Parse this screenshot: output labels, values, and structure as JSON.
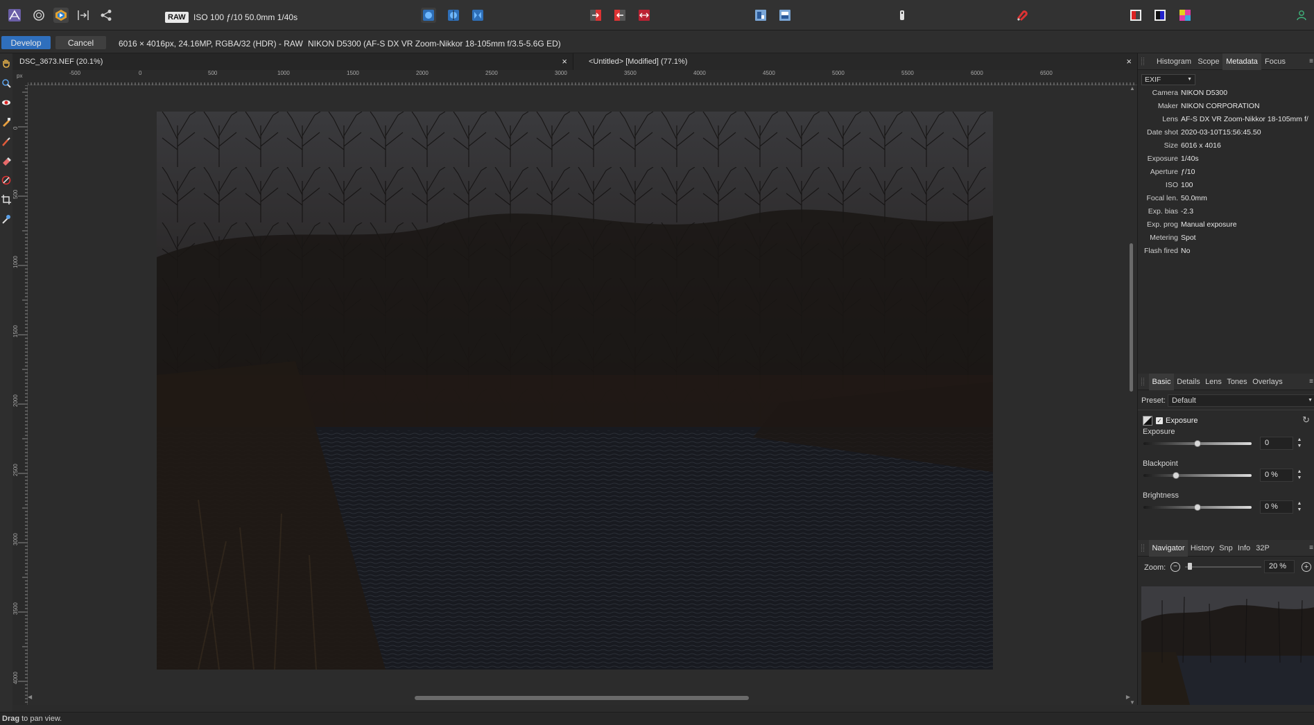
{
  "toolbar": {
    "icons": [
      "affinity-persona-icon",
      "develop-persona-icon",
      "tone-mapping-persona-icon",
      "export-persona-icon",
      "share-icon"
    ],
    "raw_badge": "RAW",
    "exposure_info": "ISO 100 ƒ/10 50.0mm 1/40s"
  },
  "context": {
    "develop_label": "Develop",
    "cancel_label": "Cancel",
    "image_info": "6016 × 4016px, 24.16MP, RGBA/32 (HDR) - RAW",
    "lens_info": "NIKON D5300 (AF-S DX VR Zoom-Nikkor 18-105mm f/3.5-5.6G ED)"
  },
  "doc_tabs": [
    {
      "label": "DSC_3673.NEF (20.1%)",
      "close": "×"
    },
    {
      "label": "<Untitled> [Modified] (77.1%)",
      "close": "×"
    }
  ],
  "ruler": {
    "unit": "px",
    "h_labels": [
      "-500",
      "0",
      "500",
      "1000",
      "1500",
      "2000",
      "2500",
      "3000",
      "3500",
      "4000",
      "4500",
      "5000",
      "5500",
      "6000",
      "6500"
    ],
    "v_labels": [
      "0",
      "500",
      "1000",
      "1500",
      "2000",
      "2500",
      "3000",
      "3500",
      "4000"
    ]
  },
  "panel_top": {
    "tabs": [
      "Histogram",
      "Scope",
      "Metadata",
      "Focus"
    ],
    "active": "Metadata",
    "dropdown": "EXIF",
    "rows": [
      {
        "k": "Camera",
        "v": "NIKON D5300"
      },
      {
        "k": "Maker",
        "v": "NIKON CORPORATION"
      },
      {
        "k": "Lens",
        "v": "AF-S DX VR Zoom-Nikkor 18-105mm f/"
      },
      {
        "k": "Date shot",
        "v": "2020-03-10T15:56:45.50"
      },
      {
        "k": "Size",
        "v": "6016 x 4016"
      },
      {
        "k": "Exposure",
        "v": "1/40s"
      },
      {
        "k": "Aperture",
        "v": "ƒ/10"
      },
      {
        "k": "ISO",
        "v": "100"
      },
      {
        "k": "Focal len.",
        "v": "50.0mm"
      },
      {
        "k": "Exp. bias",
        "v": "-2.3"
      },
      {
        "k": "Exp. prog",
        "v": "Manual exposure"
      },
      {
        "k": "Metering",
        "v": "Spot"
      },
      {
        "k": "Flash fired",
        "v": "No"
      }
    ]
  },
  "panel_mid": {
    "tabs": [
      "Basic",
      "Details",
      "Lens",
      "Tones",
      "Overlays"
    ],
    "active": "Basic",
    "preset_label": "Preset:",
    "preset_value": "Default",
    "section_title": "Exposure",
    "sliders": [
      {
        "label": "Exposure",
        "value": "0",
        "pos": 0.5
      },
      {
        "label": "Blackpoint",
        "value": "0 %",
        "pos": 0.3
      },
      {
        "label": "Brightness",
        "value": "0 %",
        "pos": 0.5
      }
    ]
  },
  "panel_bottom": {
    "tabs": [
      "Navigator",
      "History",
      "Snp",
      "Info",
      "32P"
    ],
    "active": "Navigator",
    "zoom_label": "Zoom:",
    "zoom_value": "20 %"
  },
  "status": {
    "bold": "Drag",
    "text": " to pan view."
  },
  "colors": {
    "develop_button": "#2f6fbd",
    "panel_bg": "#2a2a2a",
    "canvas_bg": "#2c2c2c"
  }
}
